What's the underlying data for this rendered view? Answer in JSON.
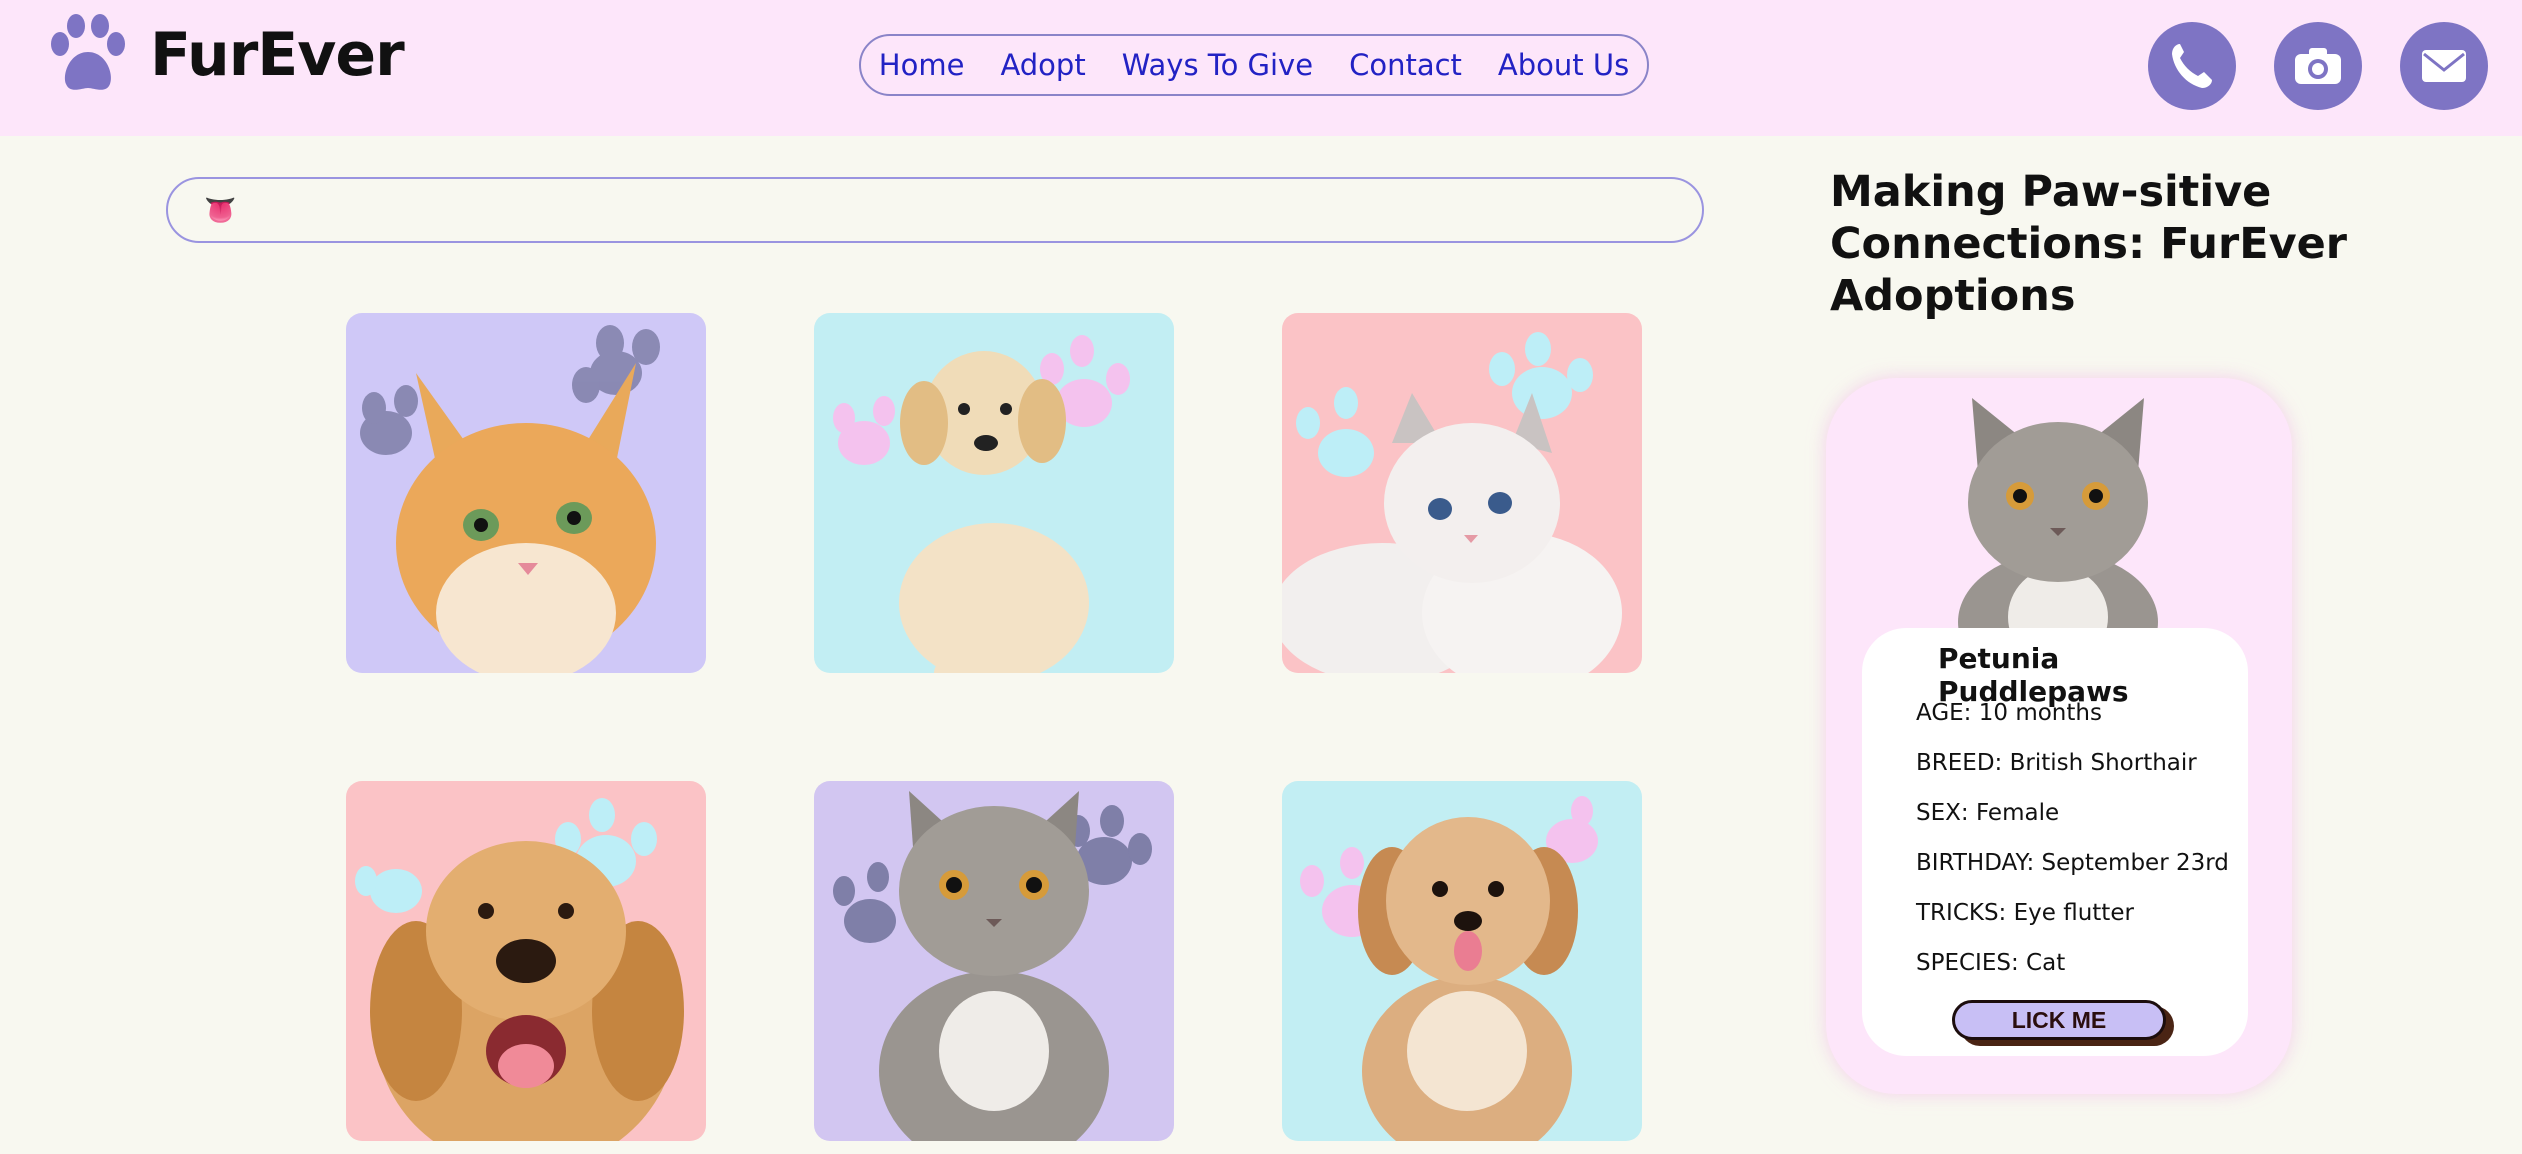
{
  "brand": {
    "name": "FurEver"
  },
  "nav": {
    "links": [
      "Home",
      "Adopt",
      "Ways To Give",
      "Contact",
      "About Us"
    ]
  },
  "contact_icons": [
    "phone-icon",
    "camera-icon",
    "mail-icon"
  ],
  "search": {
    "emoji": "👅",
    "value": ""
  },
  "pets": [
    {
      "kind": "orange-kitten",
      "bg": "#cfc8f7",
      "paw_color": "#7f7fa8"
    },
    {
      "kind": "golden-puppy",
      "bg": "#c2eef3",
      "paw_color": "#f4c2ee"
    },
    {
      "kind": "white-kitten",
      "bg": "#fbc3c6",
      "paw_color": "#bdeef7"
    },
    {
      "kind": "golden-retriever",
      "bg": "#fbc3c6",
      "paw_color": "#bdeef7"
    },
    {
      "kind": "grey-cat",
      "bg": "#d2c6f1",
      "paw_color": "#7f7fa8"
    },
    {
      "kind": "fluffy-puppy",
      "bg": "#c2eef3",
      "paw_color": "#f4c2ee"
    }
  ],
  "panel": {
    "title": "Making Paw-sitive Connections: FurEver Adoptions"
  },
  "profile": {
    "name": "Petunia Puddlepaws",
    "age": "AGE: 10 months",
    "breed": "BREED: British Shorthair",
    "sex": "SEX: Female",
    "birthday": "BIRTHDAY: September 23rd",
    "tricks": "TRICKS: Eye flutter",
    "species": "SPECIES: Cat",
    "button_label": "LICK ME"
  },
  "colors": {
    "header_bg": "#fde6fa",
    "page_bg": "#f8f8f0",
    "accent": "#7e74c4",
    "nav_text": "#2222c4"
  }
}
